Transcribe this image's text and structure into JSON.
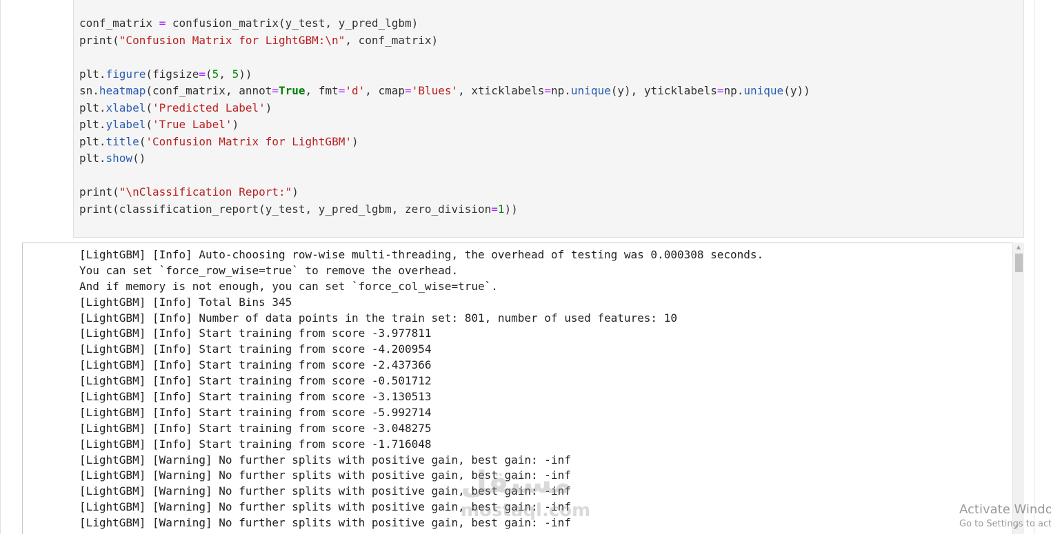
{
  "code_cell": {
    "lines": [
      "conf_matrix = confusion_matrix(y_test, y_pred_lgbm)",
      "print(\"Confusion Matrix for LightGBM:\\n\", conf_matrix)",
      "",
      "plt.figure(figsize=(5, 5))",
      "sn.heatmap(conf_matrix, annot=True, fmt='d', cmap='Blues', xticklabels=np.unique(y), yticklabels=np.unique(y))",
      "plt.xlabel('Predicted Label')",
      "plt.ylabel('True Label')",
      "plt.title('Confusion Matrix for LightGBM')",
      "plt.show()",
      "",
      "print(\"\\nClassification Report:\")",
      "print(classification_report(y_test, y_pred_lgbm, zero_division=1))"
    ]
  },
  "output": {
    "lines": [
      "[LightGBM] [Info] Auto-choosing row-wise multi-threading, the overhead of testing was 0.000308 seconds.",
      "You can set `force_row_wise=true` to remove the overhead.",
      "And if memory is not enough, you can set `force_col_wise=true`.",
      "[LightGBM] [Info] Total Bins 345",
      "[LightGBM] [Info] Number of data points in the train set: 801, number of used features: 10",
      "[LightGBM] [Info] Start training from score -3.977811",
      "[LightGBM] [Info] Start training from score -4.200954",
      "[LightGBM] [Info] Start training from score -2.437366",
      "[LightGBM] [Info] Start training from score -0.501712",
      "[LightGBM] [Info] Start training from score -3.130513",
      "[LightGBM] [Info] Start training from score -5.992714",
      "[LightGBM] [Info] Start training from score -3.048275",
      "[LightGBM] [Info] Start training from score -1.716048",
      "[LightGBM] [Warning] No further splits with positive gain, best gain: -inf",
      "[LightGBM] [Warning] No further splits with positive gain, best gain: -inf",
      "[LightGBM] [Warning] No further splits with positive gain, best gain: -inf",
      "[LightGBM] [Warning] No further splits with positive gain, best gain: -inf",
      "[LightGBM] [Warning] No further splits with positive gain, best gain: -inf"
    ]
  },
  "scrollbar": {
    "up_arrow_icon": "triangle-up-icon",
    "resize_icon": "resize-grip-icon"
  },
  "watermark": {
    "arabic": "مستقل",
    "latin": "mostaql.com"
  },
  "os_overlay": {
    "title": "Activate Windows",
    "subtitle": "Go to Settings to activate Windows."
  },
  "colors": {
    "code_background": "#f5f5f5",
    "string": "#ba2121",
    "keyword": "#008000",
    "function": "#2a5db0",
    "operator": "#aa22ff",
    "number": "#008800"
  }
}
